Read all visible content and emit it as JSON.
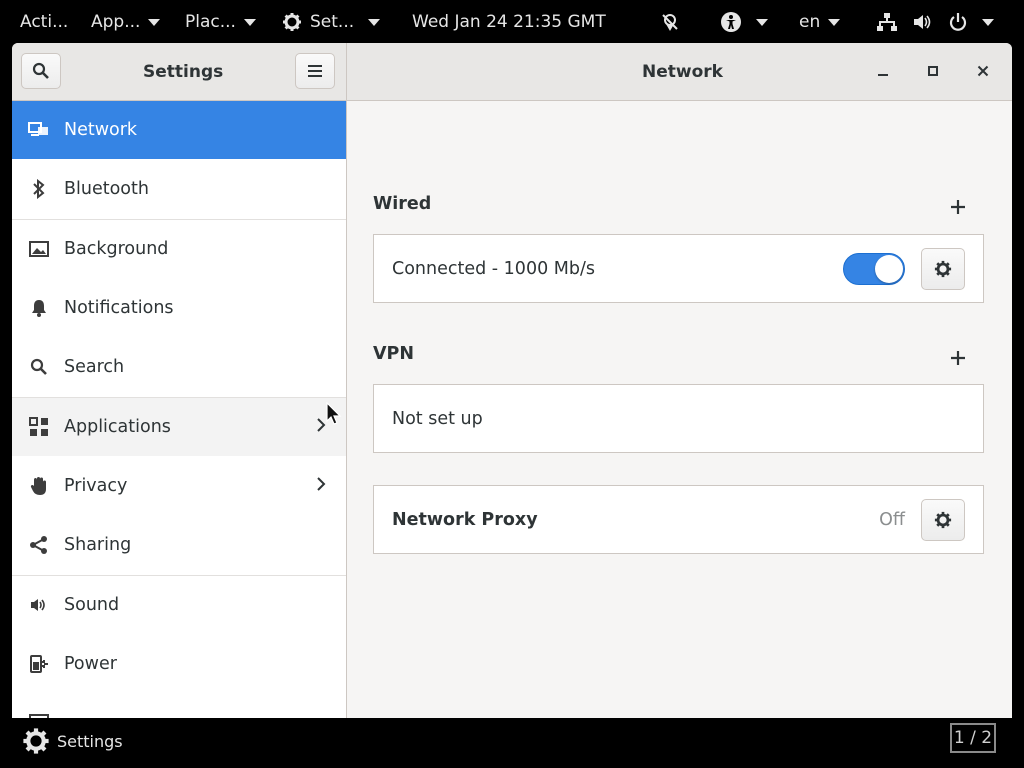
{
  "topbar": {
    "activities": "Acti...",
    "applications": "App...",
    "places": "Plac...",
    "settings_menu": "Set...",
    "clock": "Wed Jan 24  21:35 GMT",
    "language": "en"
  },
  "window": {
    "sidebar_title": "Settings",
    "content_title": "Network"
  },
  "sidebar": {
    "items": [
      {
        "label": "Network",
        "icon": "network-icon",
        "active": true
      },
      {
        "label": "Bluetooth",
        "icon": "bluetooth-icon"
      },
      {
        "label": "Background",
        "icon": "background-icon"
      },
      {
        "label": "Notifications",
        "icon": "bell-icon"
      },
      {
        "label": "Search",
        "icon": "search-icon"
      },
      {
        "label": "Applications",
        "icon": "applications-icon",
        "has_submenu": true
      },
      {
        "label": "Privacy",
        "icon": "hand-icon",
        "has_submenu": true
      },
      {
        "label": "Sharing",
        "icon": "share-icon"
      },
      {
        "label": "Sound",
        "icon": "speaker-icon"
      },
      {
        "label": "Power",
        "icon": "power-plug-icon"
      }
    ]
  },
  "network": {
    "wired": {
      "title": "Wired",
      "status": "Connected - 1000 Mb/s",
      "enabled": true
    },
    "vpn": {
      "title": "VPN",
      "status": "Not set up"
    },
    "proxy": {
      "title": "Network Proxy",
      "status": "Off"
    }
  },
  "taskbar": {
    "app_label": "Settings",
    "workspace": "1 / 2"
  },
  "colors": {
    "accent": "#3584e4",
    "topbar_bg": "#000000",
    "window_bg": "#f6f5f4"
  }
}
